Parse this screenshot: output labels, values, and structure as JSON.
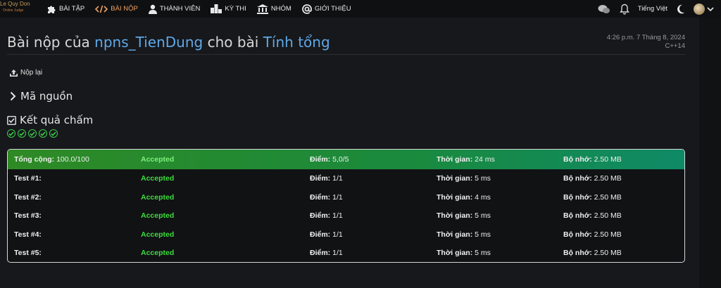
{
  "logo": {
    "line1": "Le Quy Don",
    "line2": "Online Judge"
  },
  "nav": {
    "items": [
      {
        "label": "BÀI TẬP",
        "icon": "puzzle-icon"
      },
      {
        "label": "BÀI NỘP",
        "icon": "code-icon",
        "active": true
      },
      {
        "label": "THÀNH VIÊN",
        "icon": "user-icon"
      },
      {
        "label": "KỲ THI",
        "icon": "podium-icon"
      },
      {
        "label": "NHÓM",
        "icon": "institution-icon"
      },
      {
        "label": "GIỚI THIỆU",
        "icon": "at-icon"
      }
    ],
    "language": "Tiếng Việt"
  },
  "submission": {
    "title_prefix": "Bài nộp của",
    "user": "npns_TienDung",
    "title_middle": "cho bài",
    "problem": "Tính tổng",
    "datetime": "4:26 p.m. 7 Tháng 8, 2024",
    "language": "C++14",
    "resubmit_label": "Nộp lại",
    "source_label": "Mã nguồn",
    "result_label": "Kết quả chấm",
    "check_count": 5
  },
  "labels": {
    "point": "Điểm:",
    "time": "Thời gian:",
    "memory": "Bộ nhớ:"
  },
  "total": {
    "name": "Tổng cộng:",
    "score": "100.0/100",
    "status": "Accepted",
    "point": "5,0/5",
    "time": "24 ms",
    "memory": "2.50 MB"
  },
  "tests": [
    {
      "name": "Test #1:",
      "status": "Accepted",
      "point": "1/1",
      "time": "5 ms",
      "memory": "2.50 MB"
    },
    {
      "name": "Test #2:",
      "status": "Accepted",
      "point": "1/1",
      "time": "4 ms",
      "memory": "2.50 MB"
    },
    {
      "name": "Test #3:",
      "status": "Accepted",
      "point": "1/1",
      "time": "5 ms",
      "memory": "2.50 MB"
    },
    {
      "name": "Test #4:",
      "status": "Accepted",
      "point": "1/1",
      "time": "5 ms",
      "memory": "2.50 MB"
    },
    {
      "name": "Test #5:",
      "status": "Accepted",
      "point": "1/1",
      "time": "5 ms",
      "memory": "2.50 MB"
    }
  ],
  "colors": {
    "accepted": "#3ddc3d",
    "link": "#5fa8e8",
    "active_nav": "#f0a060"
  }
}
